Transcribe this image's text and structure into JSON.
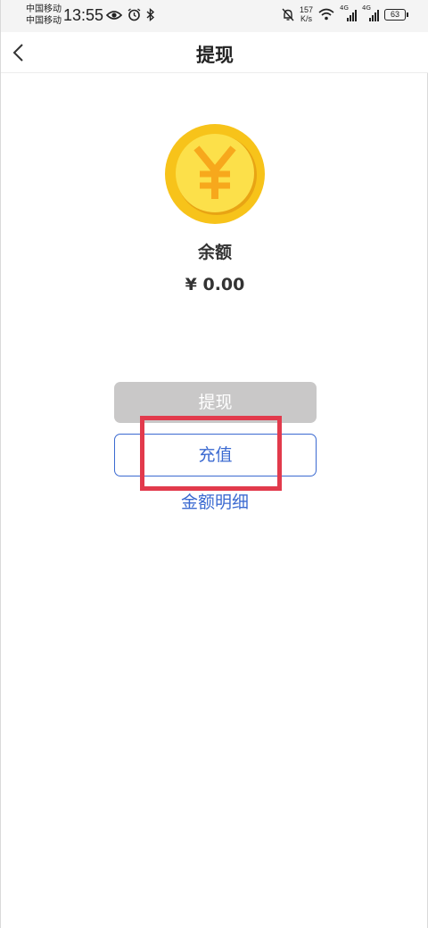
{
  "status_bar": {
    "carrier_1": "中国移动",
    "carrier_2": "中国移动",
    "time": "13:55",
    "net_speed_value": "157",
    "net_speed_unit": "K/s",
    "signal_1_tag": "4G",
    "signal_2_tag": "4G",
    "battery": "63",
    "icons": [
      "eye-icon",
      "alarm-icon",
      "bluetooth-icon",
      "mute-icon",
      "wifi-icon",
      "signal-icon",
      "battery-icon"
    ]
  },
  "nav": {
    "back_icon": "chevron-left-icon",
    "title": "提现"
  },
  "wallet": {
    "coin_icon": "yuan-coin-icon",
    "balance_label": "余额",
    "balance_amount": "¥ 0.00"
  },
  "actions": {
    "withdraw_label": "提现",
    "recharge_label": "充值",
    "detail_label": "金额明细"
  },
  "colors": {
    "accent_blue": "#3b6ad1",
    "disabled_gray": "#c9c8c8",
    "highlight_red": "#e23a4c",
    "coin_gold": "#f7c31a"
  }
}
